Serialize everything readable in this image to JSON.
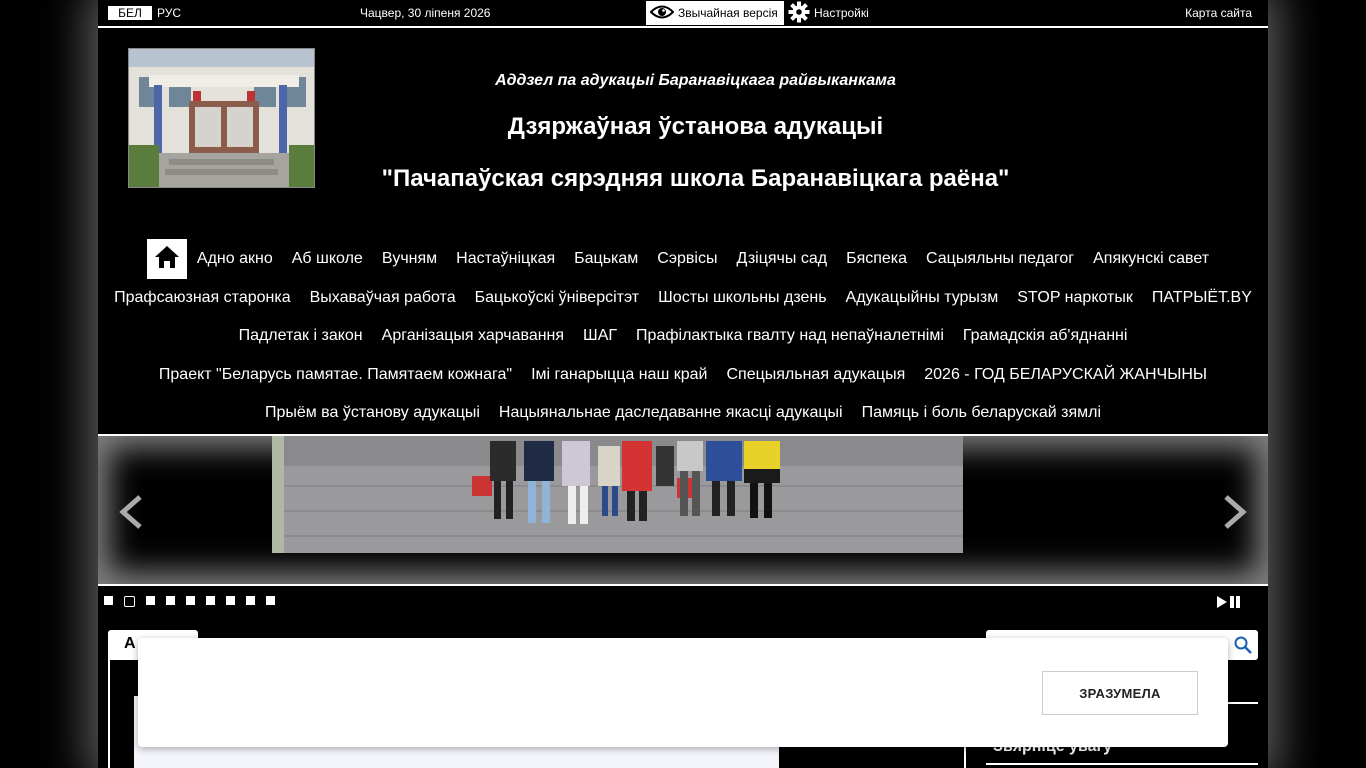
{
  "topbar": {
    "lang_bel": "БЕЛ",
    "lang_rus": "РУС",
    "date": "Чацвер, 30 ліпеня 2026",
    "normal_version": "Звычайная версія",
    "settings": "Настройкі",
    "sitemap": "Карта сайта"
  },
  "header": {
    "dept": "Аддзел па адукацыі Баранавіцкага райвыканкама",
    "title1": "Дзяржаўная ўстанова адукацыі",
    "title2": "\"Пачапаўская сярэдняя школа Баранавіцкага раёна\""
  },
  "nav": {
    "rows": [
      [
        "Адно акно",
        "Аб школе",
        "Вучням",
        "Настаўніцкая",
        "Бацькам",
        "Сэрвісы",
        "Дзіцячы сад",
        "Бяспека",
        "Сацыяльны педагог",
        "Апякунскі савет"
      ],
      [
        "Прафсаюзная старонка",
        "Выхаваўчая работа",
        "Бацькоўскі ўніверсітэт",
        "Шосты школьны дзень",
        "Адукацыйны турызм",
        "STOP наркотык",
        "ПАТРЫЁТ.BY"
      ],
      [
        "Падлетак і закон",
        "Арганізацыя харчавання",
        "ШАГ",
        "Прафілактыка гвалту над непаўналетнімі",
        "Грамадскія аб'яднанні"
      ],
      [
        "Праект \"Беларусь памятае. Памятаем кожнага\"",
        "Імі ганарыцца наш край",
        "Спецыяльная адукацыя",
        "2026 - ГОД БЕЛАРУСКАЙ ЖАНЧЫНЫ"
      ],
      [
        "Прыём ва ўстанову адукацыі",
        "Нацыянальнае даследаванне якасці адукацыі",
        "Памяць і боль беларускай зямлі"
      ]
    ]
  },
  "slider": {
    "dot_count": 9,
    "active_dot": 1
  },
  "content": {
    "tab_label": "А",
    "attention": "Звярніце ўвагу"
  },
  "cookie": {
    "button_label": "ЗРАЗУМЕЛА"
  },
  "colors": {
    "background": "#000000",
    "foreground": "#ffffff"
  }
}
